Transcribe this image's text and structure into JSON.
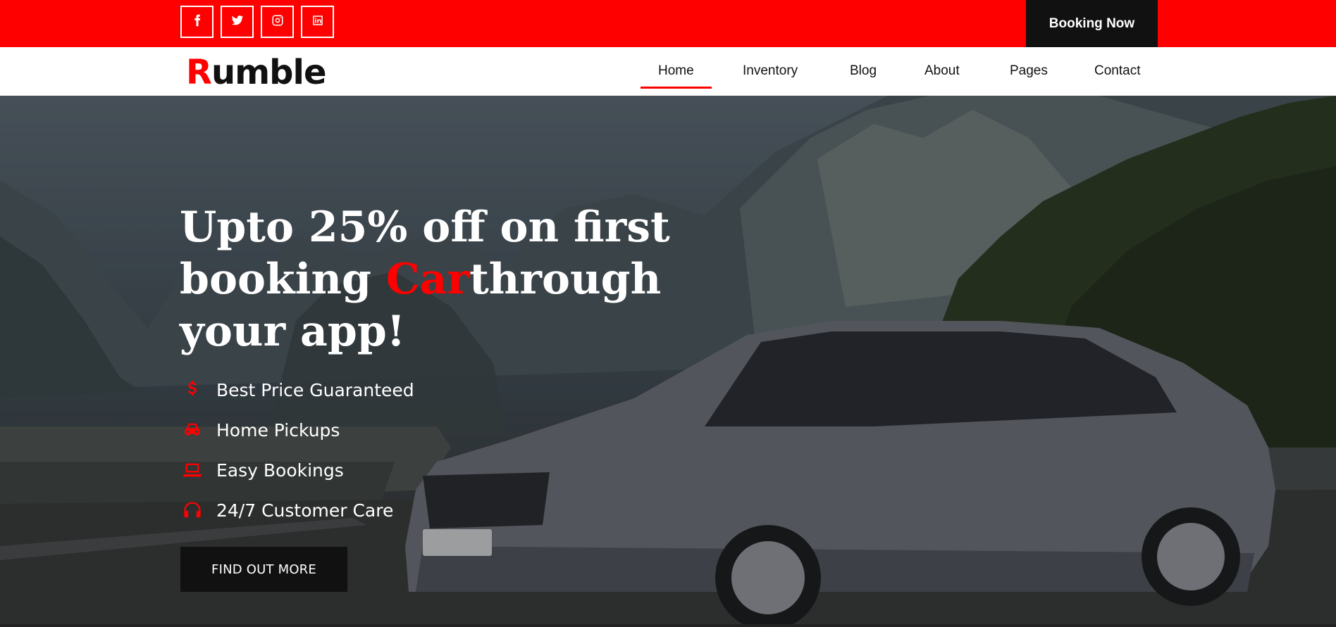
{
  "topbar": {
    "social": [
      {
        "icon": "facebook-icon"
      },
      {
        "icon": "twitter-icon"
      },
      {
        "icon": "instagram-icon"
      },
      {
        "icon": "linkedin-icon"
      }
    ],
    "booking_label": "Booking Now"
  },
  "nav": {
    "logo_first": "R",
    "logo_rest": "umble",
    "items": [
      "Home",
      "Inventory",
      "Blog",
      "About",
      "Pages",
      "Contact"
    ],
    "active": "Home"
  },
  "hero": {
    "title_part1": "Upto 25% off on first booking ",
    "title_accent": "Car",
    "title_part2": "through your app!",
    "features": [
      {
        "icon": "dollar-icon",
        "label": "Best Price Guaranteed"
      },
      {
        "icon": "car-icon",
        "label": "Home Pickups"
      },
      {
        "icon": "laptop-icon",
        "label": "Easy Bookings"
      },
      {
        "icon": "headphones-icon",
        "label": "24/7 Customer Care"
      }
    ],
    "cta_label": "FIND OUT MORE"
  },
  "colors": {
    "accent": "#ff0000",
    "dark": "#111111",
    "white": "#ffffff"
  }
}
